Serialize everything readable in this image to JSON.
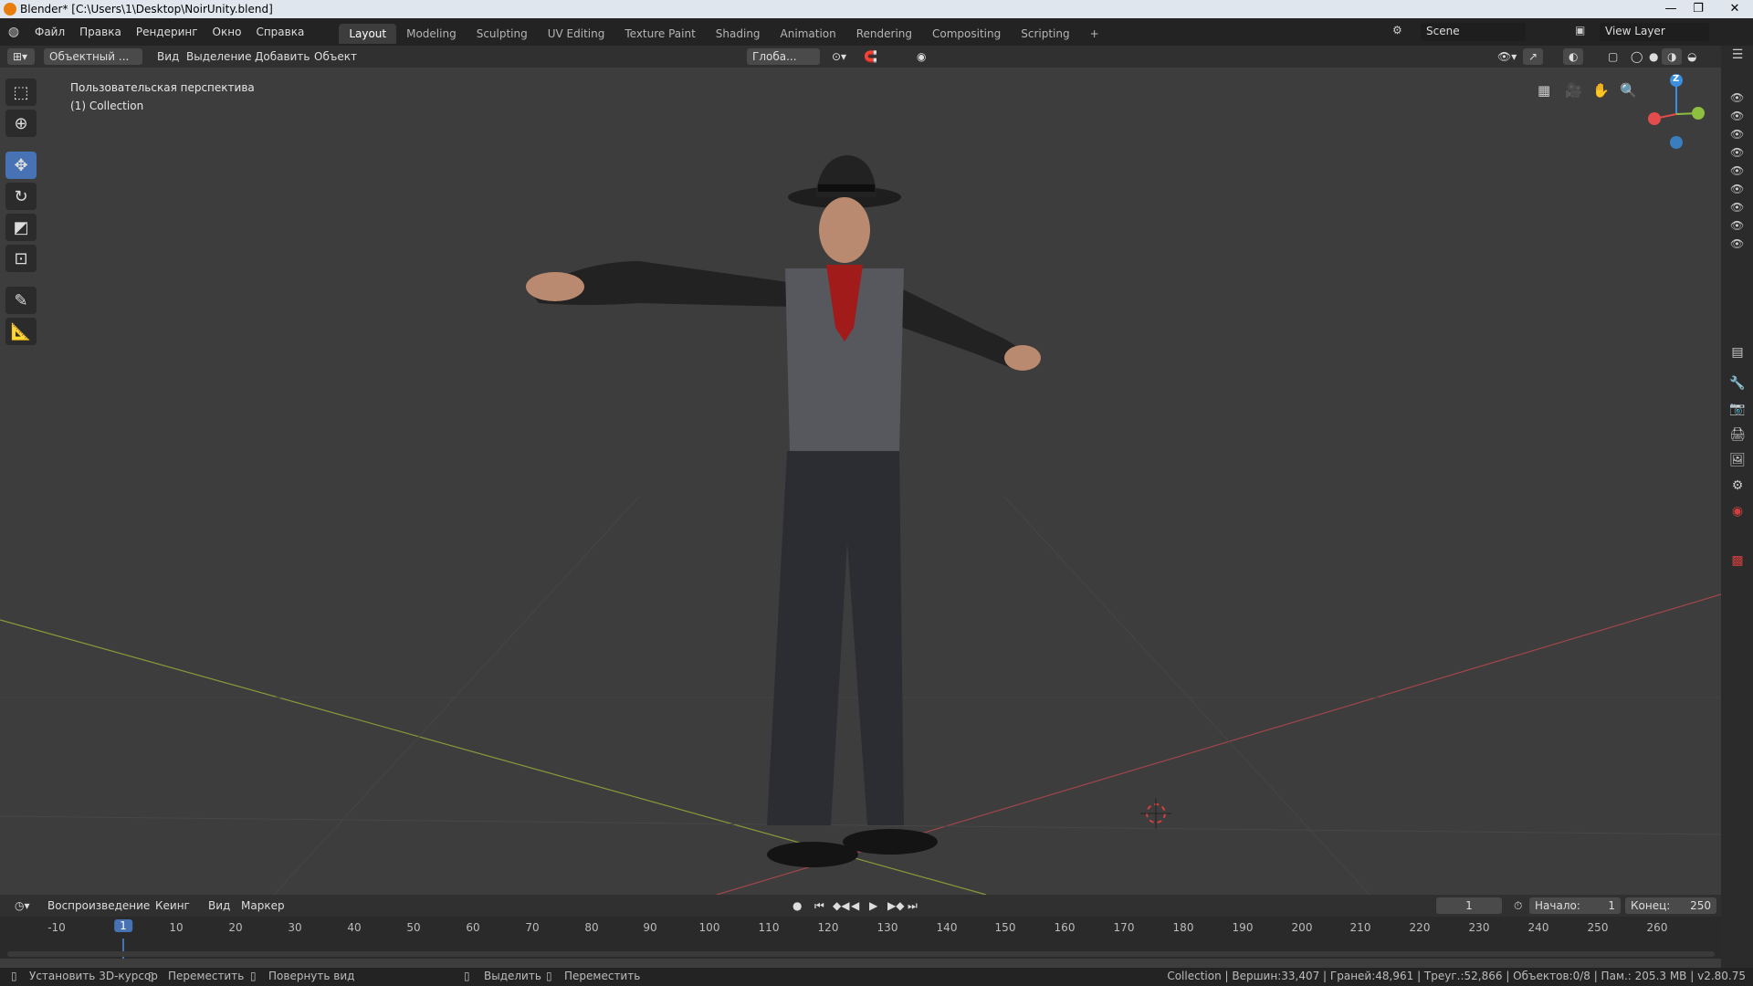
{
  "window": {
    "title": "Blender* [C:\\Users\\1\\Desktop\\NoirUnity.blend]"
  },
  "menu": {
    "items": [
      "Файл",
      "Правка",
      "Рендеринг",
      "Окно",
      "Справка"
    ]
  },
  "workspaces": {
    "tabs": [
      "Layout",
      "Modeling",
      "Sculpting",
      "UV Editing",
      "Texture Paint",
      "Shading",
      "Animation",
      "Rendering",
      "Compositing",
      "Scripting"
    ],
    "active": "Layout",
    "add_symbol": "+"
  },
  "scene": {
    "name": "Scene"
  },
  "view_layer": {
    "name": "View Layer"
  },
  "header": {
    "mode": "Объектный ...",
    "items": [
      "Вид",
      "Выделение",
      "Добавить",
      "Объект"
    ],
    "transform_orientation": "Глоба..."
  },
  "viewport": {
    "perspective_label": "Пользовательская перспектива",
    "collection_label": "(1) Collection",
    "gizmo_axis_label": "Z"
  },
  "timeline": {
    "menu": [
      "Воспроизведение",
      "Кеинг",
      "Вид",
      "Маркер"
    ],
    "current_frame": "1",
    "start_label": "Начало:",
    "start_value": "1",
    "end_label": "Конец:",
    "end_value": "250",
    "ruler_ticks": [
      "-10",
      "1",
      "10",
      "20",
      "30",
      "40",
      "50",
      "60",
      "70",
      "80",
      "90",
      "100",
      "110",
      "120",
      "130",
      "140",
      "150",
      "160",
      "170",
      "180",
      "190",
      "200",
      "210",
      "220",
      "230",
      "240",
      "250",
      "260"
    ]
  },
  "statusbar": {
    "hints": [
      "Установить 3D-курсор",
      "Переместить",
      "Повернуть вид",
      "Выделить",
      "Переместить"
    ],
    "stats": "Collection | Вершин:33,407 | Граней:48,961 | Треуг.:52,866 | Объектов:0/8 | Пам.: 205.3 MB | v2.80.75"
  },
  "colors": {
    "accent": "#4772b3",
    "viewport_bg": "#3d3d3d",
    "x_axis": "#a0464a",
    "y_axis": "#8a9a3a",
    "gizmo_x": "#e34c4c",
    "gizmo_y": "#8fbf3f",
    "gizmo_z": "#3a8fde"
  }
}
